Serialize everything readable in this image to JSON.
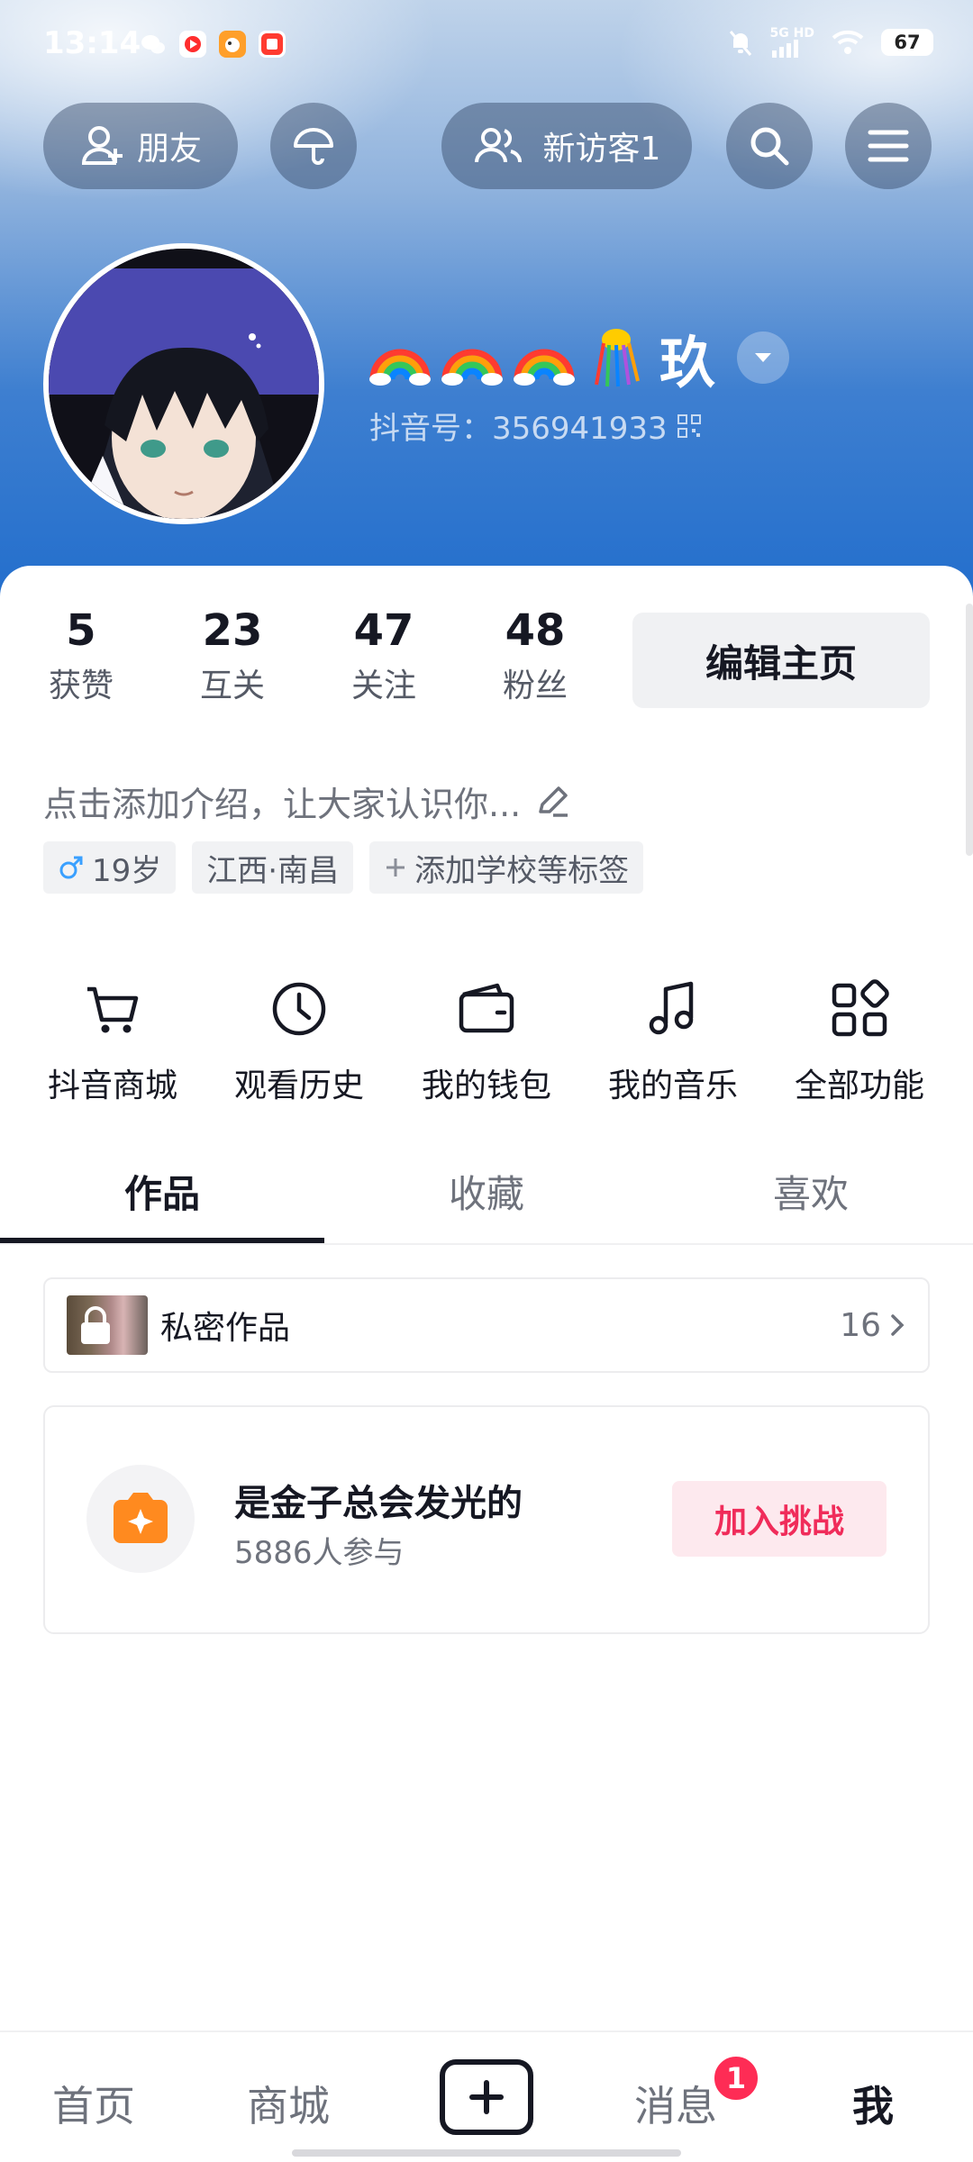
{
  "status_bar": {
    "time": "13:14",
    "network": "5G HD",
    "battery": "67"
  },
  "top_bar": {
    "friends_label": "朋友",
    "visitors_label": "新访客1"
  },
  "profile": {
    "nickname_suffix": "玖",
    "douyin_id": "抖音号：356941933"
  },
  "stats": [
    {
      "value": "5",
      "label": "获赞"
    },
    {
      "value": "23",
      "label": "互关"
    },
    {
      "value": "47",
      "label": "关注"
    },
    {
      "value": "48",
      "label": "粉丝"
    }
  ],
  "edit_profile_label": "编辑主页",
  "bio_placeholder": "点击添加介绍，让大家认识你...",
  "tags": {
    "age": "19岁",
    "location": "江西·南昌",
    "add_tag": "添加学校等标签"
  },
  "shortcuts": [
    {
      "label": "抖音商城",
      "icon": "cart-icon"
    },
    {
      "label": "观看历史",
      "icon": "clock-icon"
    },
    {
      "label": "我的钱包",
      "icon": "wallet-icon"
    },
    {
      "label": "我的音乐",
      "icon": "music-icon"
    },
    {
      "label": "全部功能",
      "icon": "grid-icon"
    }
  ],
  "tabs": [
    "作品",
    "收藏",
    "喜欢"
  ],
  "private_works": {
    "label": "私密作品",
    "count": "16"
  },
  "challenge": {
    "title": "是金子总会发光的",
    "participants": "5886人参与",
    "join_label": "加入挑战"
  },
  "bottom_nav": {
    "home": "首页",
    "mall": "商城",
    "messages": "消息",
    "messages_badge": "1",
    "me": "我"
  },
  "colors": {
    "accent": "#fe2c55",
    "challenge_orange": "#ff8a1f"
  }
}
